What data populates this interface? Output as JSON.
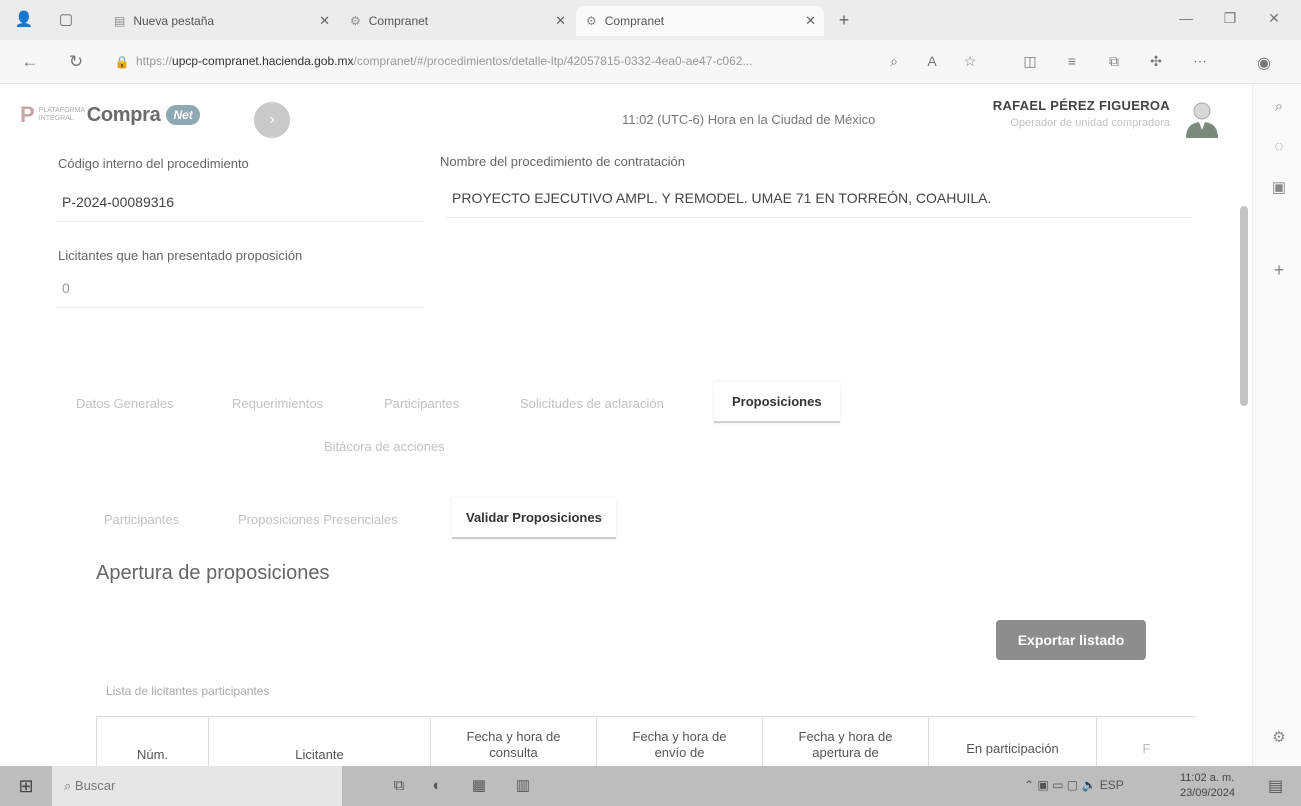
{
  "browser": {
    "tabs": [
      {
        "label": "Nueva pestaña",
        "active": false
      },
      {
        "label": "Compranet",
        "active": false
      },
      {
        "label": "Compranet",
        "active": true
      }
    ],
    "new_tab": "+",
    "url_prefix": "https://",
    "url_host": "upcp-compranet.hacienda.gob.mx",
    "url_path": "/compranet/#/procedimientos/detalle-ltp/42057815-0332-4ea0-ae47-c062..."
  },
  "header": {
    "logo_small": "Plataforma Integral",
    "logo_word": "Compra",
    "logo_badge": "Net",
    "time": "11:02 (UTC-6) Hora en la Ciudad de México",
    "user_name": "RAFAEL PÉREZ FIGUEROA",
    "user_role": "Operador de unidad compradora"
  },
  "procedure": {
    "code_label": "Código interno del procedimiento",
    "code_value": "P-2024-00089316",
    "name_label": "Nombre del procedimiento de contratación",
    "name_value": "PROYECTO EJECUTIVO AMPL. Y REMODEL. UMAE 71 EN TORREÓN, COAHUILA.",
    "bidders_label": "Licitantes que han presentado proposición",
    "bidders_value": "0"
  },
  "main_tabs": {
    "t1": "Datos Generales",
    "t2": "Requerimientos",
    "t3": "Participantes",
    "t4": "Solicitudes de aclaración",
    "t5": "Proposiciones",
    "t6": "Bitácora de acciones"
  },
  "sub_tabs": {
    "s1": "Participantes",
    "s2": "Proposiciones Presenciales",
    "s3": "Validar Proposiciones"
  },
  "section": {
    "title": "Apertura de proposiciones",
    "export_label": "Exportar listado",
    "list_label": "Lista de licitantes participantes"
  },
  "table": {
    "columns": [
      "Núm.",
      "Licitante",
      "Fecha y hora de consulta",
      "Fecha y hora de envío de",
      "Fecha y hora de apertura de",
      "En participación",
      "F"
    ]
  },
  "taskbar": {
    "search": "Buscar",
    "lang": "ESP",
    "time": "11:02 a. m.",
    "date": "23/09/2024"
  }
}
